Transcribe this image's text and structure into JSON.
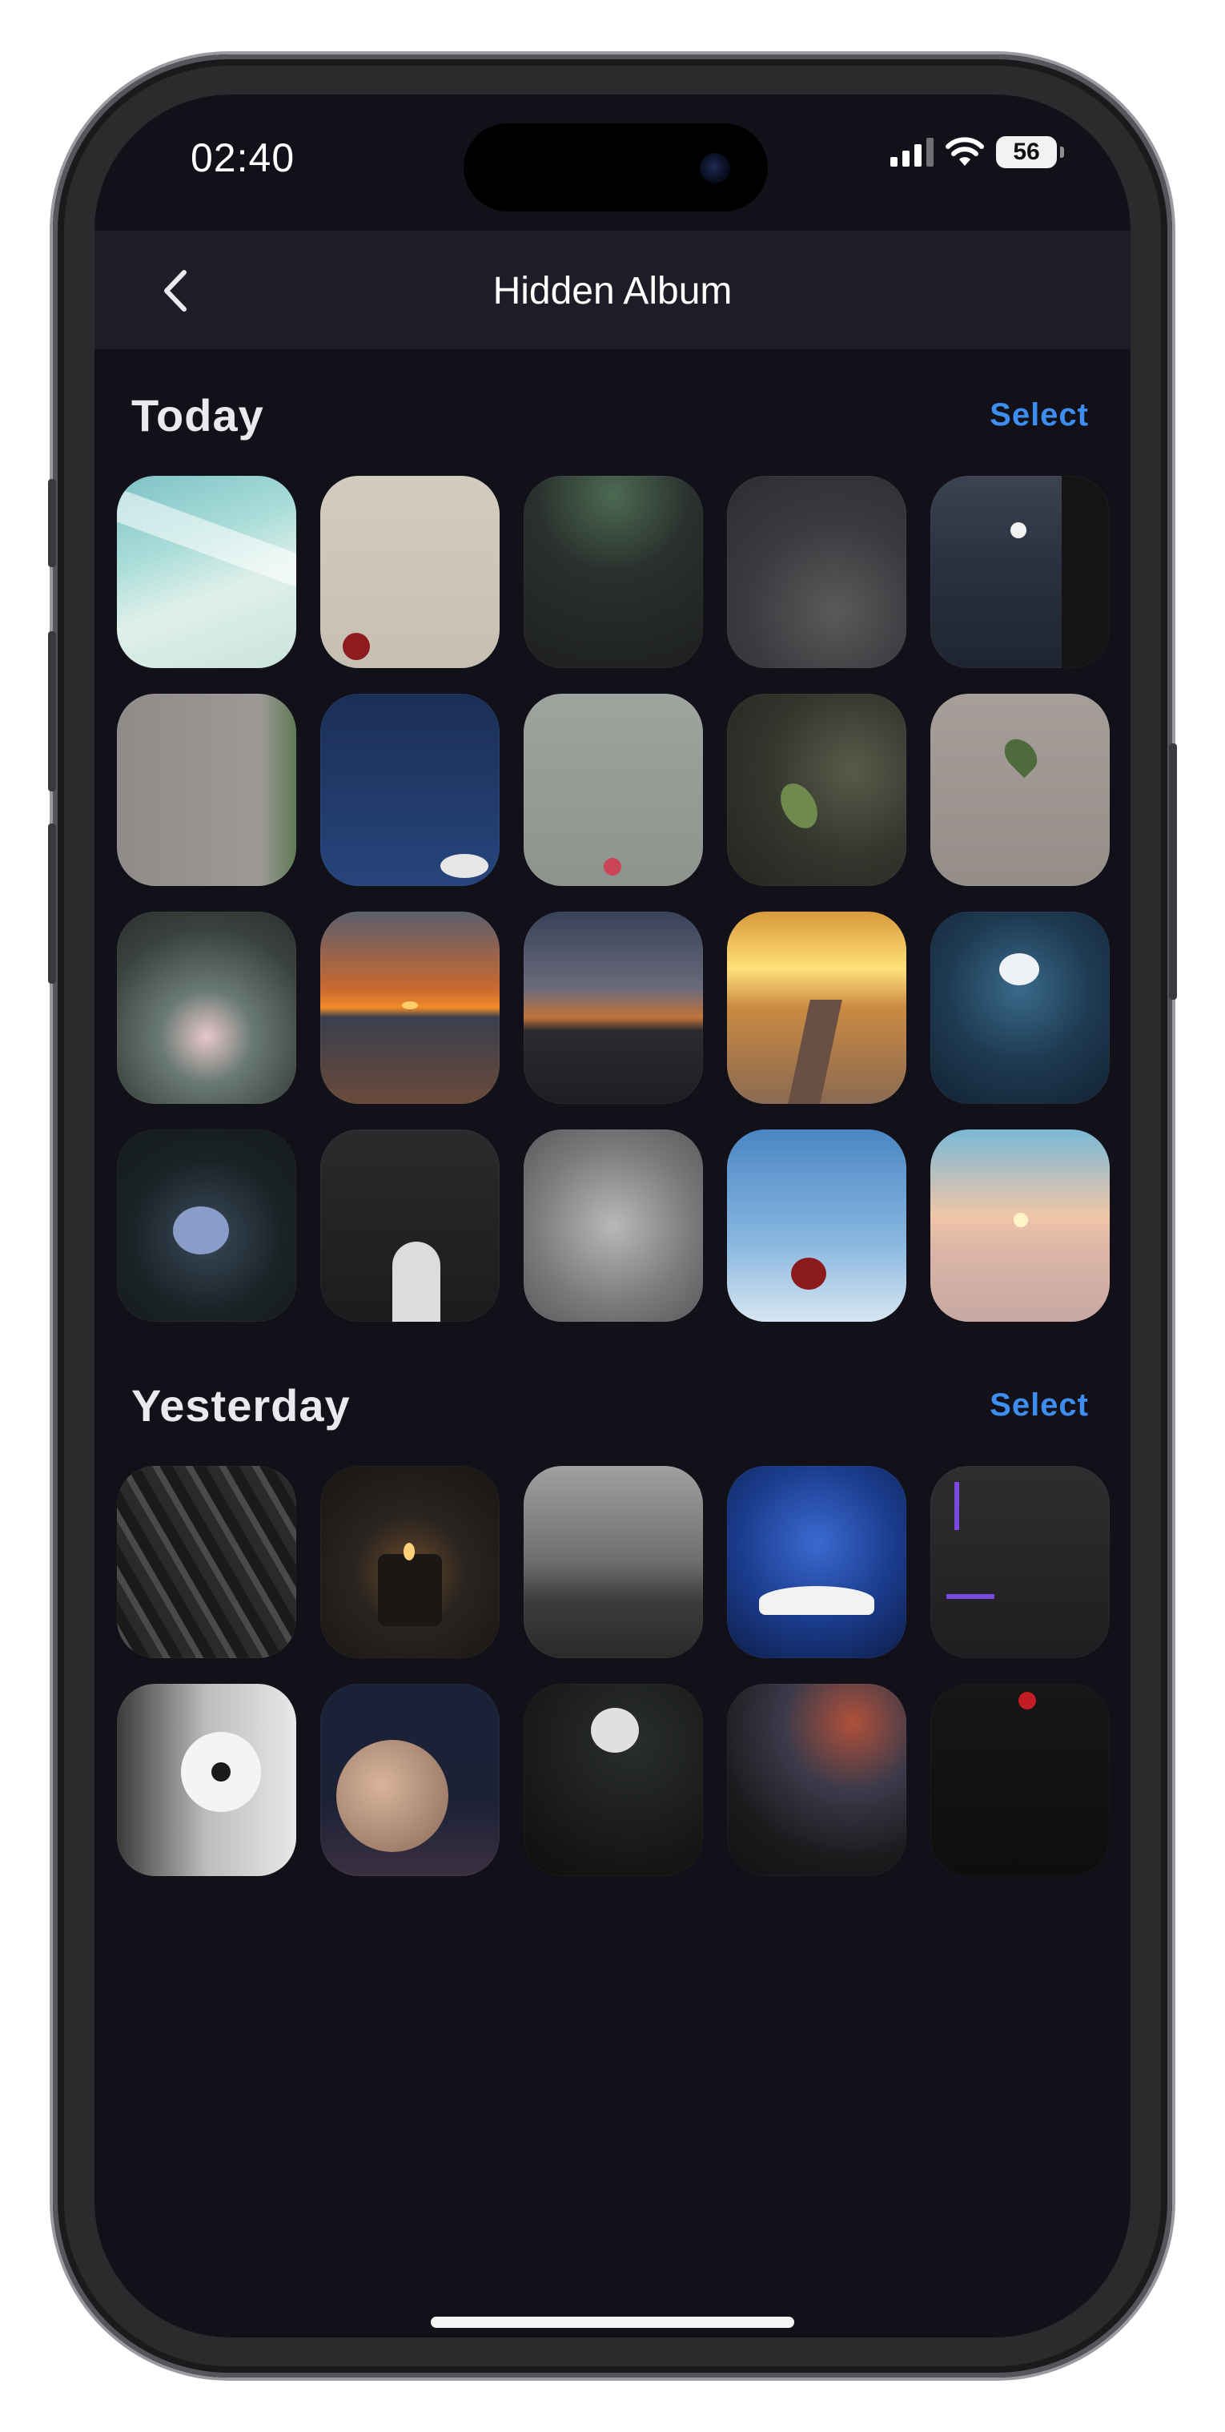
{
  "status_bar": {
    "time": "02:40",
    "battery": "56",
    "icons": [
      "cellular-signal-icon",
      "wifi-icon",
      "battery-icon"
    ]
  },
  "navbar": {
    "title": "Hidden Album",
    "back_icon": "chevron-left-icon"
  },
  "colors": {
    "background": "#12111a",
    "navbar": "#1d1d27",
    "accent": "#3d8ef0",
    "text": "#e9e9ef"
  },
  "sections": [
    {
      "title": "Today",
      "select_label": "Select",
      "photo_count": 20
    },
    {
      "title": "Yesterday",
      "select_label": "Select",
      "photo_count": 10
    }
  ]
}
